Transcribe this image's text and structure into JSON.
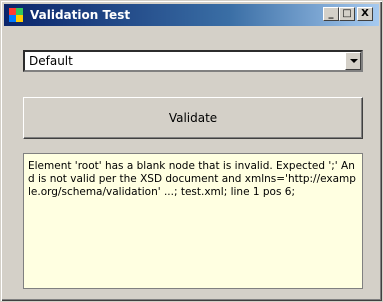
{
  "window": {
    "title": "Validation Test",
    "minimize_label": "_",
    "maximize_label": "□",
    "close_label": "X"
  },
  "dropdown": {
    "value": "Default"
  },
  "validate_button": {
    "label": "Validate"
  },
  "output": {
    "text": "Element 'root' has a blank node that is invalid. Expected ';' And is not valid per the XSD document and xmlns='http://example.org/schema/validation' ...; test.xml; line 1 pos 6;"
  }
}
